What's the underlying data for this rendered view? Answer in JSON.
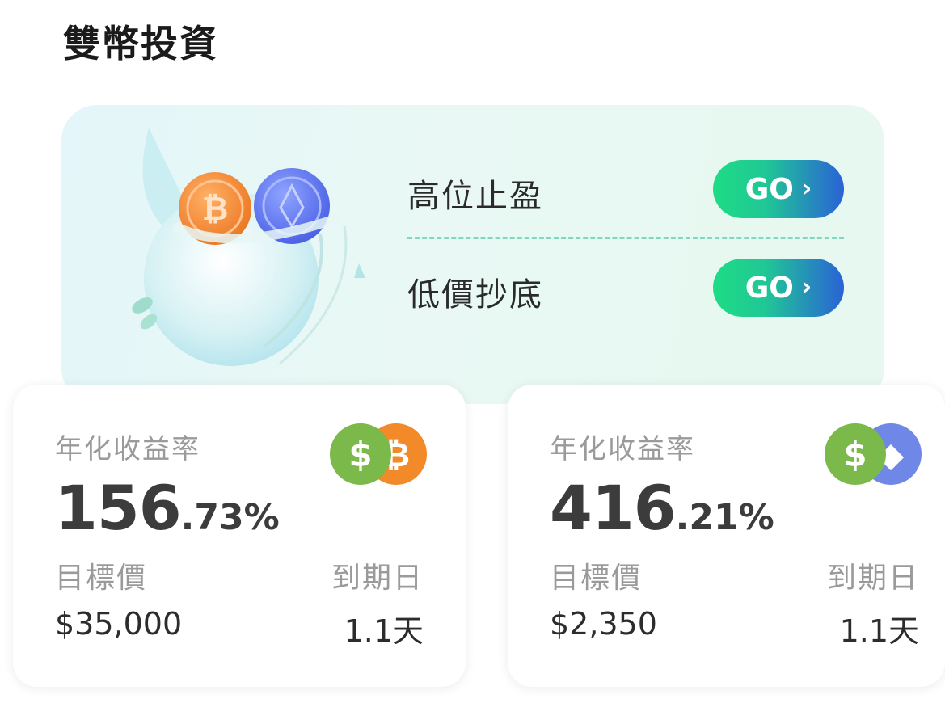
{
  "page": {
    "title": "雙幣投資"
  },
  "hero": {
    "options": [
      {
        "label": "高位止盈",
        "button": "GO"
      },
      {
        "label": "低價抄底",
        "button": "GO"
      }
    ],
    "colors": {
      "button_start": "#1edc84",
      "button_end": "#2a62d6",
      "divider": "#7fd9c2"
    }
  },
  "products": [
    {
      "apy_label": "年化收益率",
      "apy_int": "156",
      "apy_dec": ".73%",
      "price_label": "目標價",
      "price_value": "$35,000",
      "expiry_label": "到期日",
      "expiry_value": "1.1天",
      "coins": [
        "usd-coin-icon",
        "btc-coin-icon"
      ]
    },
    {
      "apy_label": "年化收益率",
      "apy_int": "416",
      "apy_dec": ".21%",
      "price_label": "目標價",
      "price_value": "$2,350",
      "expiry_label": "到期日",
      "expiry_value": "1.1天",
      "coins": [
        "usd-coin-icon",
        "eth-coin-icon"
      ]
    }
  ],
  "coin_glyphs": {
    "usd": "$",
    "btc": "₿",
    "eth": "◆"
  }
}
